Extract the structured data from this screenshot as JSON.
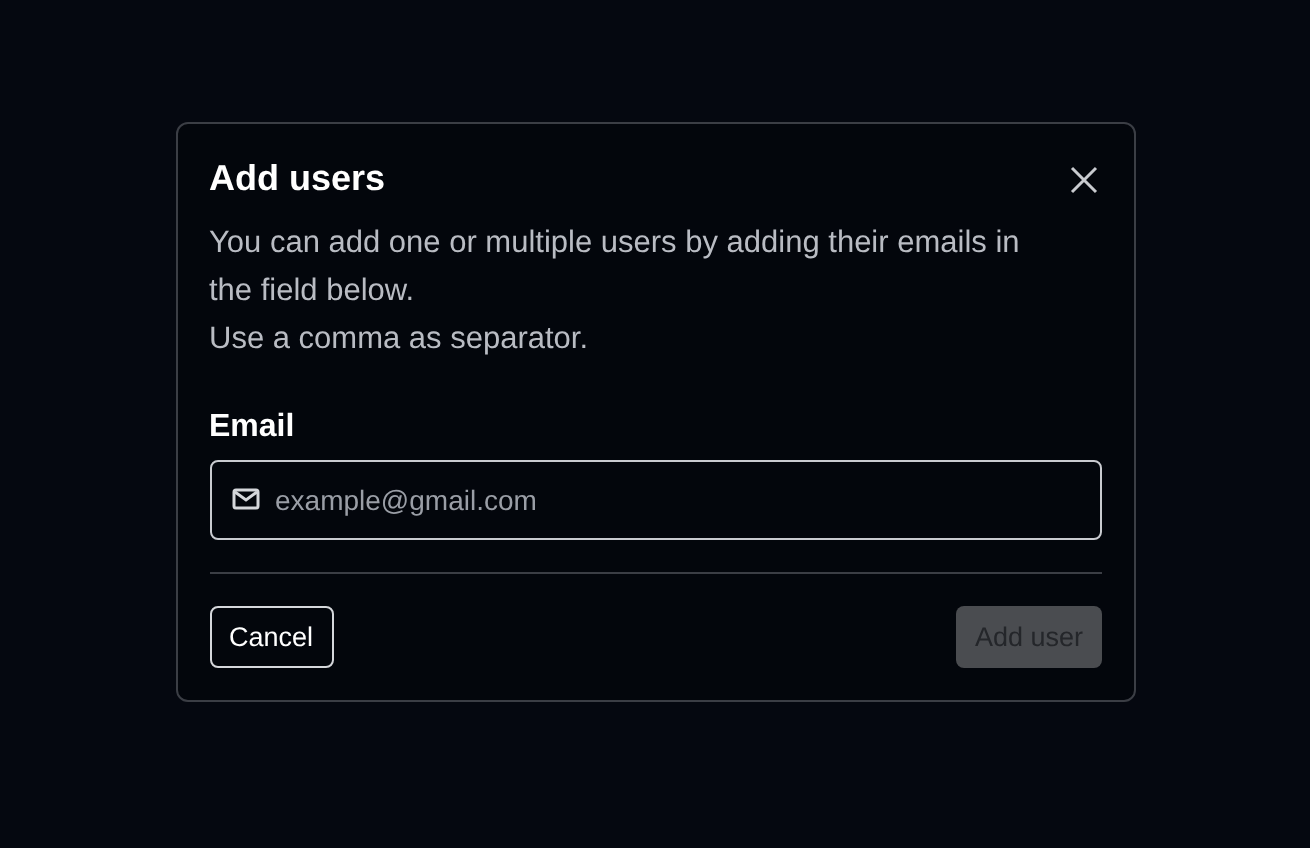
{
  "dialog": {
    "title": "Add users",
    "description": [
      "You can add one or multiple users by adding their emails in the field below.",
      "Use a comma as separator."
    ],
    "email": {
      "label": "Email",
      "placeholder": "example@gmail.com"
    },
    "buttons": [
      {
        "label": "Cancel",
        "kind": "secondary",
        "disabled": false
      },
      {
        "label": "Add user",
        "kind": "primary",
        "disabled": true
      }
    ]
  }
}
